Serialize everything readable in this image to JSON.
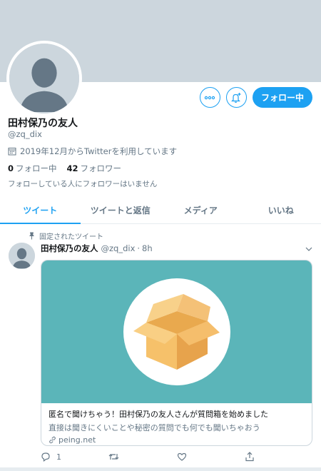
{
  "profile": {
    "name": "田村保乃の友人",
    "handle": "@zq_dix",
    "joined": "2019年12月からTwitterを利用しています",
    "following_count": "0",
    "following_label": "フォロー中",
    "followers_count": "42",
    "followers_label": "フォロワー",
    "notice": "フォローしている人にフォロワーはいません",
    "follow_button": "フォロー中"
  },
  "tabs": [
    {
      "label": "ツイート",
      "active": true
    },
    {
      "label": "ツイートと返信",
      "active": false
    },
    {
      "label": "メディア",
      "active": false
    },
    {
      "label": "いいね",
      "active": false
    }
  ],
  "pinned": {
    "label": "固定されたツイート"
  },
  "tweet": {
    "name": "田村保乃の友人",
    "handle": "@zq_dix",
    "dot": "·",
    "time": "8h",
    "card": {
      "title": "匿名で聞けちゃう！田村保乃の友人さんが質問箱を始めました",
      "description": "直接は聞きにくいことや秘密の質問でも何でも聞いちゃおう",
      "domain": "peing.net"
    },
    "reply_count": "1"
  },
  "icons": {
    "more": "more-icon",
    "notify": "notification-add-icon",
    "calendar": "calendar-icon",
    "pin": "pin-icon",
    "chevron": "chevron-down-icon",
    "link": "link-icon",
    "reply": "reply-icon",
    "retweet": "retweet-icon",
    "like": "heart-icon",
    "share": "share-icon"
  },
  "colors": {
    "accent": "#1da1f2",
    "banner": "#ccd6dd",
    "card_bg": "#5bb5b9",
    "muted": "#657786"
  }
}
